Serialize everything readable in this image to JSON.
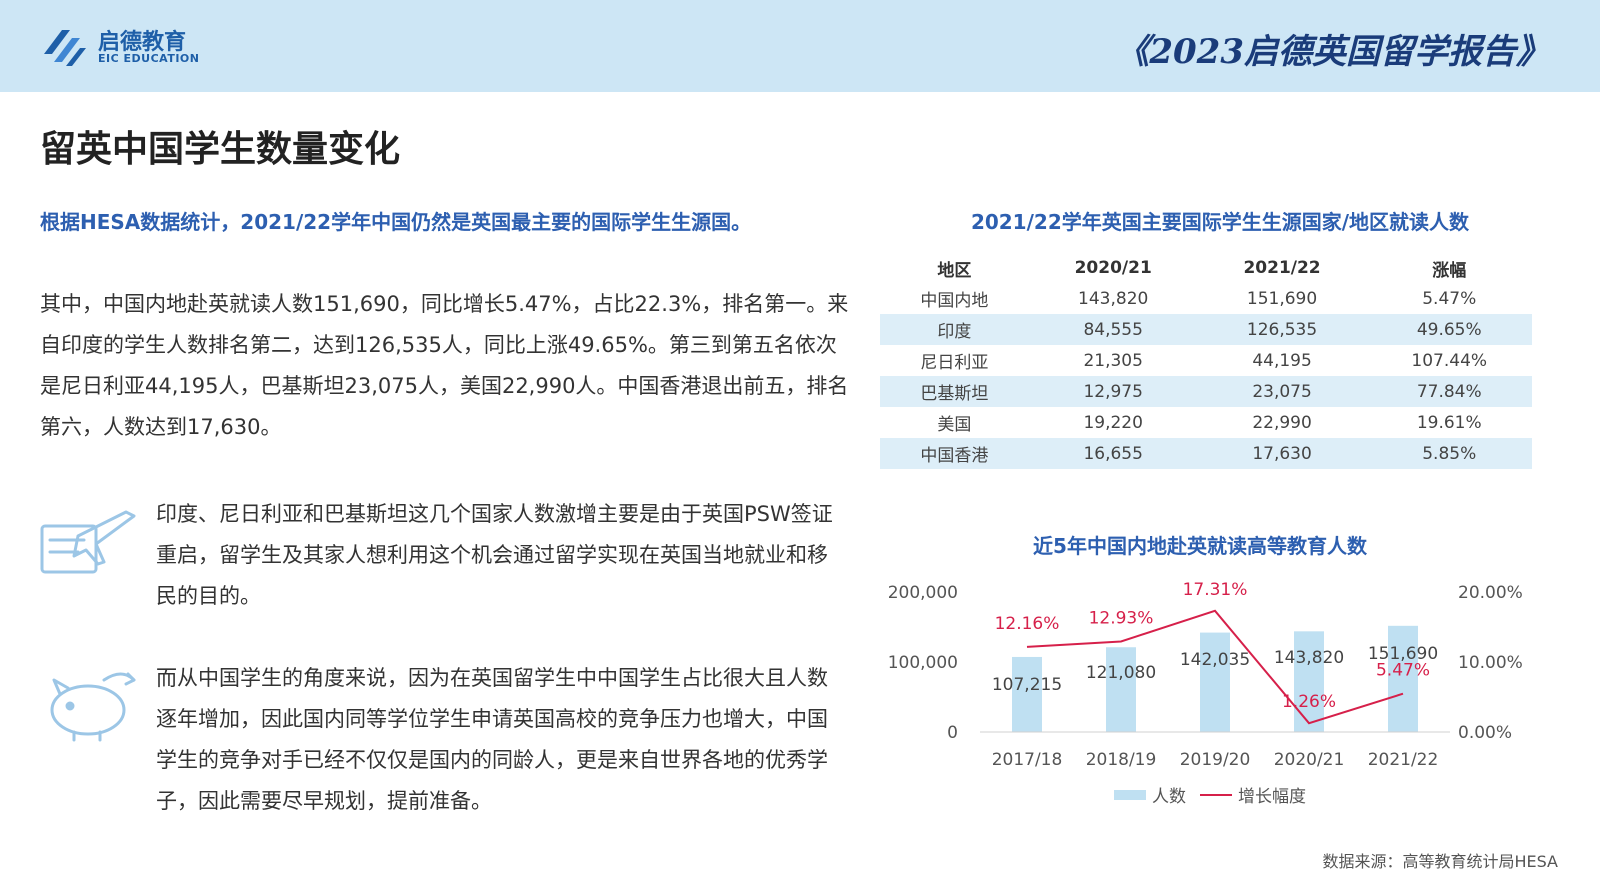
{
  "header": {
    "logo_cn": "启德教育",
    "logo_en": "EIC EDUCATION",
    "report_title": "《2023启德英国留学报告》"
  },
  "colors": {
    "accent": "#2d5fb0",
    "bar": "#bfe0f2",
    "line": "#d6204a",
    "band": "#cde6f5"
  },
  "page_title": "留英中国学生数量变化",
  "highlight": "根据HESA数据统计，2021/22学年中国仍然是英国最主要的国际学生生源国。",
  "paragraphs": {
    "p1": "其中，中国内地赴英就读人数151,690，同比增长5.47%，占比22.3%，排名第一。来自印度的学生人数排名第二，达到126,535人，同比上涨49.65%。第三到第五名依次是尼日利亚44,195人，巴基斯坦23,075人，美国22,990人。中国香港退出前五，排名第六，人数达到17,630。",
    "p2": "印度、尼日利亚和巴基斯坦这几个国家人数激增主要是由于英国PSW签证重启，留学生及其家人想利用这个机会通过留学实现在英国当地就业和移民的目的。",
    "p3": "而从中国学生的角度来说，因为在英国留学生中中国学生占比很大且人数逐年增加，因此国内同等学位学生申请英国高校的竞争压力也增大，中国学生的竞争对手已经不仅仅是国内的同龄人，更是来自世界各地的优秀学子，因此需要尽早规划，提前准备。"
  },
  "icons": {
    "plane": "airplane-icon",
    "piggy": "piggy-bank-icon"
  },
  "table": {
    "title": "2021/22学年英国主要国际学生生源国家/地区就读人数",
    "headers": [
      "地区",
      "2020/21",
      "2021/22",
      "涨幅"
    ],
    "rows": [
      [
        "中国内地",
        "143,820",
        "151,690",
        "5.47%"
      ],
      [
        "印度",
        "84,555",
        "126,535",
        "49.65%"
      ],
      [
        "尼日利亚",
        "21,305",
        "44,195",
        "107.44%"
      ],
      [
        "巴基斯坦",
        "12,975",
        "23,075",
        "77.84%"
      ],
      [
        "美国",
        "19,220",
        "22,990",
        "19.61%"
      ],
      [
        "中国香港",
        "16,655",
        "17,630",
        "5.85%"
      ]
    ]
  },
  "chart_data": {
    "type": "bar",
    "title": "近5年中国内地赴英就读高等教育人数",
    "categories": [
      "2017/18",
      "2018/19",
      "2019/20",
      "2020/21",
      "2021/22"
    ],
    "series": [
      {
        "name": "人数",
        "type": "bar",
        "axis": "left",
        "values": [
          107215,
          121080,
          142035,
          143820,
          151690
        ],
        "labels": [
          "107,215",
          "121,080",
          "142,035",
          "143,820",
          "151,690"
        ]
      },
      {
        "name": "增长幅度",
        "type": "line",
        "axis": "right",
        "values": [
          12.16,
          12.93,
          17.31,
          1.26,
          5.47
        ],
        "labels": [
          "12.16%",
          "12.93%",
          "17.31%",
          "1.26%",
          "5.47%"
        ]
      }
    ],
    "left_axis": {
      "ylim": [
        0,
        200000
      ],
      "ticks": [
        0,
        100000,
        200000
      ],
      "tick_labels": [
        "0",
        "100,000",
        "200,000"
      ]
    },
    "right_axis": {
      "ylim": [
        0,
        20
      ],
      "ticks": [
        0,
        10,
        20
      ],
      "tick_labels": [
        "0.00%",
        "10.00%",
        "20.00%"
      ]
    },
    "legend_position": "bottom",
    "grid": false
  },
  "source": "数据来源：高等教育统计局HESA"
}
